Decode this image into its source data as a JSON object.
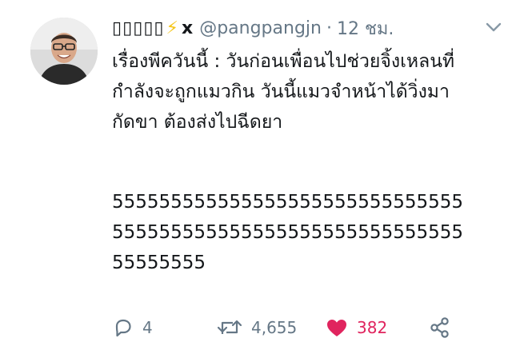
{
  "tweet": {
    "display_name": "▯▯▯▯▯",
    "bolt_glyph": "⚡",
    "x_glyph": "x",
    "handle": "@pangpangjn",
    "separator": "·",
    "time": "12 ชม.",
    "text_lines": [
      "เรื่องพีควันนี้ : วันก่อนเพื่อนไปช่วยจิ้งเหลนที่",
      "กำลังจะถูกแมวกิน วันนี้แมวจำหน้าได้วิ่งมา",
      "กัดขา ต้องส่งไปฉีดยา",
      "555555555555555555555555555555",
      "555555555555555555555555555555",
      "55555555"
    ],
    "stats": {
      "replies": "4",
      "retweets": "4,655",
      "likes": "382"
    },
    "icons": {
      "reply": "reply-icon",
      "retweet": "retweet-icon",
      "like": "heart-icon",
      "share": "share-icon",
      "menu": "chevron-down-icon"
    },
    "colors": {
      "text": "#14171a",
      "muted": "#657786",
      "like": "#e0245e",
      "bolt": "#f5c518"
    }
  }
}
